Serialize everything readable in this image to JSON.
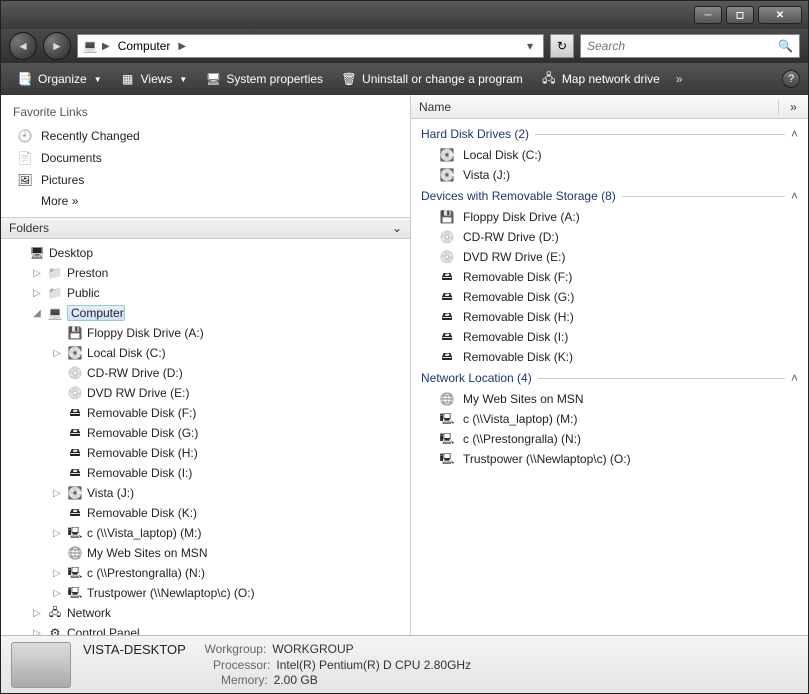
{
  "breadcrumb": {
    "root_icon": "computer",
    "item": "Computer"
  },
  "search": {
    "placeholder": "Search"
  },
  "toolbar": {
    "organize": "Organize",
    "views": "Views",
    "sys_props": "System properties",
    "uninstall": "Uninstall or change a program",
    "map_drive": "Map network drive"
  },
  "favorites": {
    "header": "Favorite Links",
    "items": [
      {
        "icon": "clock",
        "label": "Recently Changed"
      },
      {
        "icon": "doc",
        "label": "Documents"
      },
      {
        "icon": "pic",
        "label": "Pictures"
      }
    ],
    "more": "More"
  },
  "folders_header": "Folders",
  "tree": [
    {
      "depth": 1,
      "exp": "",
      "icon": "desktop",
      "label": "Desktop"
    },
    {
      "depth": 2,
      "exp": "▷",
      "icon": "folder",
      "label": "Preston"
    },
    {
      "depth": 2,
      "exp": "▷",
      "icon": "folder",
      "label": "Public"
    },
    {
      "depth": 2,
      "exp": "◢",
      "icon": "computer",
      "label": "Computer",
      "selected": true
    },
    {
      "depth": 3,
      "exp": "",
      "icon": "floppy",
      "label": "Floppy Disk Drive (A:)"
    },
    {
      "depth": 3,
      "exp": "▷",
      "icon": "drive",
      "label": "Local Disk (C:)"
    },
    {
      "depth": 3,
      "exp": "",
      "icon": "cd",
      "label": "CD-RW Drive (D:)"
    },
    {
      "depth": 3,
      "exp": "",
      "icon": "cd",
      "label": "DVD RW Drive (E:)"
    },
    {
      "depth": 3,
      "exp": "",
      "icon": "usb",
      "label": "Removable Disk (F:)"
    },
    {
      "depth": 3,
      "exp": "",
      "icon": "usb",
      "label": "Removable Disk (G:)"
    },
    {
      "depth": 3,
      "exp": "",
      "icon": "usb",
      "label": "Removable Disk (H:)"
    },
    {
      "depth": 3,
      "exp": "",
      "icon": "usb",
      "label": "Removable Disk (I:)"
    },
    {
      "depth": 3,
      "exp": "▷",
      "icon": "drive",
      "label": "Vista (J:)"
    },
    {
      "depth": 3,
      "exp": "",
      "icon": "usb",
      "label": "Removable Disk (K:)"
    },
    {
      "depth": 3,
      "exp": "▷",
      "icon": "netdrive",
      "label": "c (\\\\Vista_laptop) (M:)"
    },
    {
      "depth": 3,
      "exp": "",
      "icon": "web",
      "label": "My Web Sites on MSN"
    },
    {
      "depth": 3,
      "exp": "▷",
      "icon": "netdrive",
      "label": "c (\\\\Prestongralla) (N:)"
    },
    {
      "depth": 3,
      "exp": "▷",
      "icon": "netdrive",
      "label": "Trustpower (\\\\Newlaptop\\c) (O:)"
    },
    {
      "depth": 2,
      "exp": "▷",
      "icon": "net",
      "label": "Network"
    },
    {
      "depth": 2,
      "exp": "▷",
      "icon": "cp",
      "label": "Control Panel"
    }
  ],
  "columns": {
    "name": "Name"
  },
  "groups": [
    {
      "title": "Hard Disk Drives (2)",
      "items": [
        {
          "icon": "drive",
          "label": "Local Disk (C:)"
        },
        {
          "icon": "drive",
          "label": "Vista (J:)"
        }
      ]
    },
    {
      "title": "Devices with Removable Storage (8)",
      "items": [
        {
          "icon": "floppy",
          "label": "Floppy Disk Drive (A:)"
        },
        {
          "icon": "cd",
          "label": "CD-RW Drive (D:)"
        },
        {
          "icon": "cd",
          "label": "DVD RW Drive (E:)"
        },
        {
          "icon": "usb",
          "label": "Removable Disk (F:)"
        },
        {
          "icon": "usb",
          "label": "Removable Disk (G:)"
        },
        {
          "icon": "usb",
          "label": "Removable Disk (H:)"
        },
        {
          "icon": "usb",
          "label": "Removable Disk (I:)"
        },
        {
          "icon": "usb",
          "label": "Removable Disk (K:)"
        }
      ]
    },
    {
      "title": "Network Location (4)",
      "items": [
        {
          "icon": "web",
          "label": "My Web Sites on MSN"
        },
        {
          "icon": "netdrive",
          "label": "c (\\\\Vista_laptop) (M:)"
        },
        {
          "icon": "netdrive",
          "label": "c (\\\\Prestongralla) (N:)"
        },
        {
          "icon": "netdrive",
          "label": "Trustpower (\\\\Newlaptop\\c) (O:)"
        }
      ]
    }
  ],
  "details": {
    "name": "VISTA-DESKTOP",
    "workgroup_label": "Workgroup:",
    "workgroup": "WORKGROUP",
    "processor_label": "Processor:",
    "processor": "Intel(R) Pentium(R) D CPU 2.80GHz",
    "memory_label": "Memory:",
    "memory": "2.00 GB"
  }
}
